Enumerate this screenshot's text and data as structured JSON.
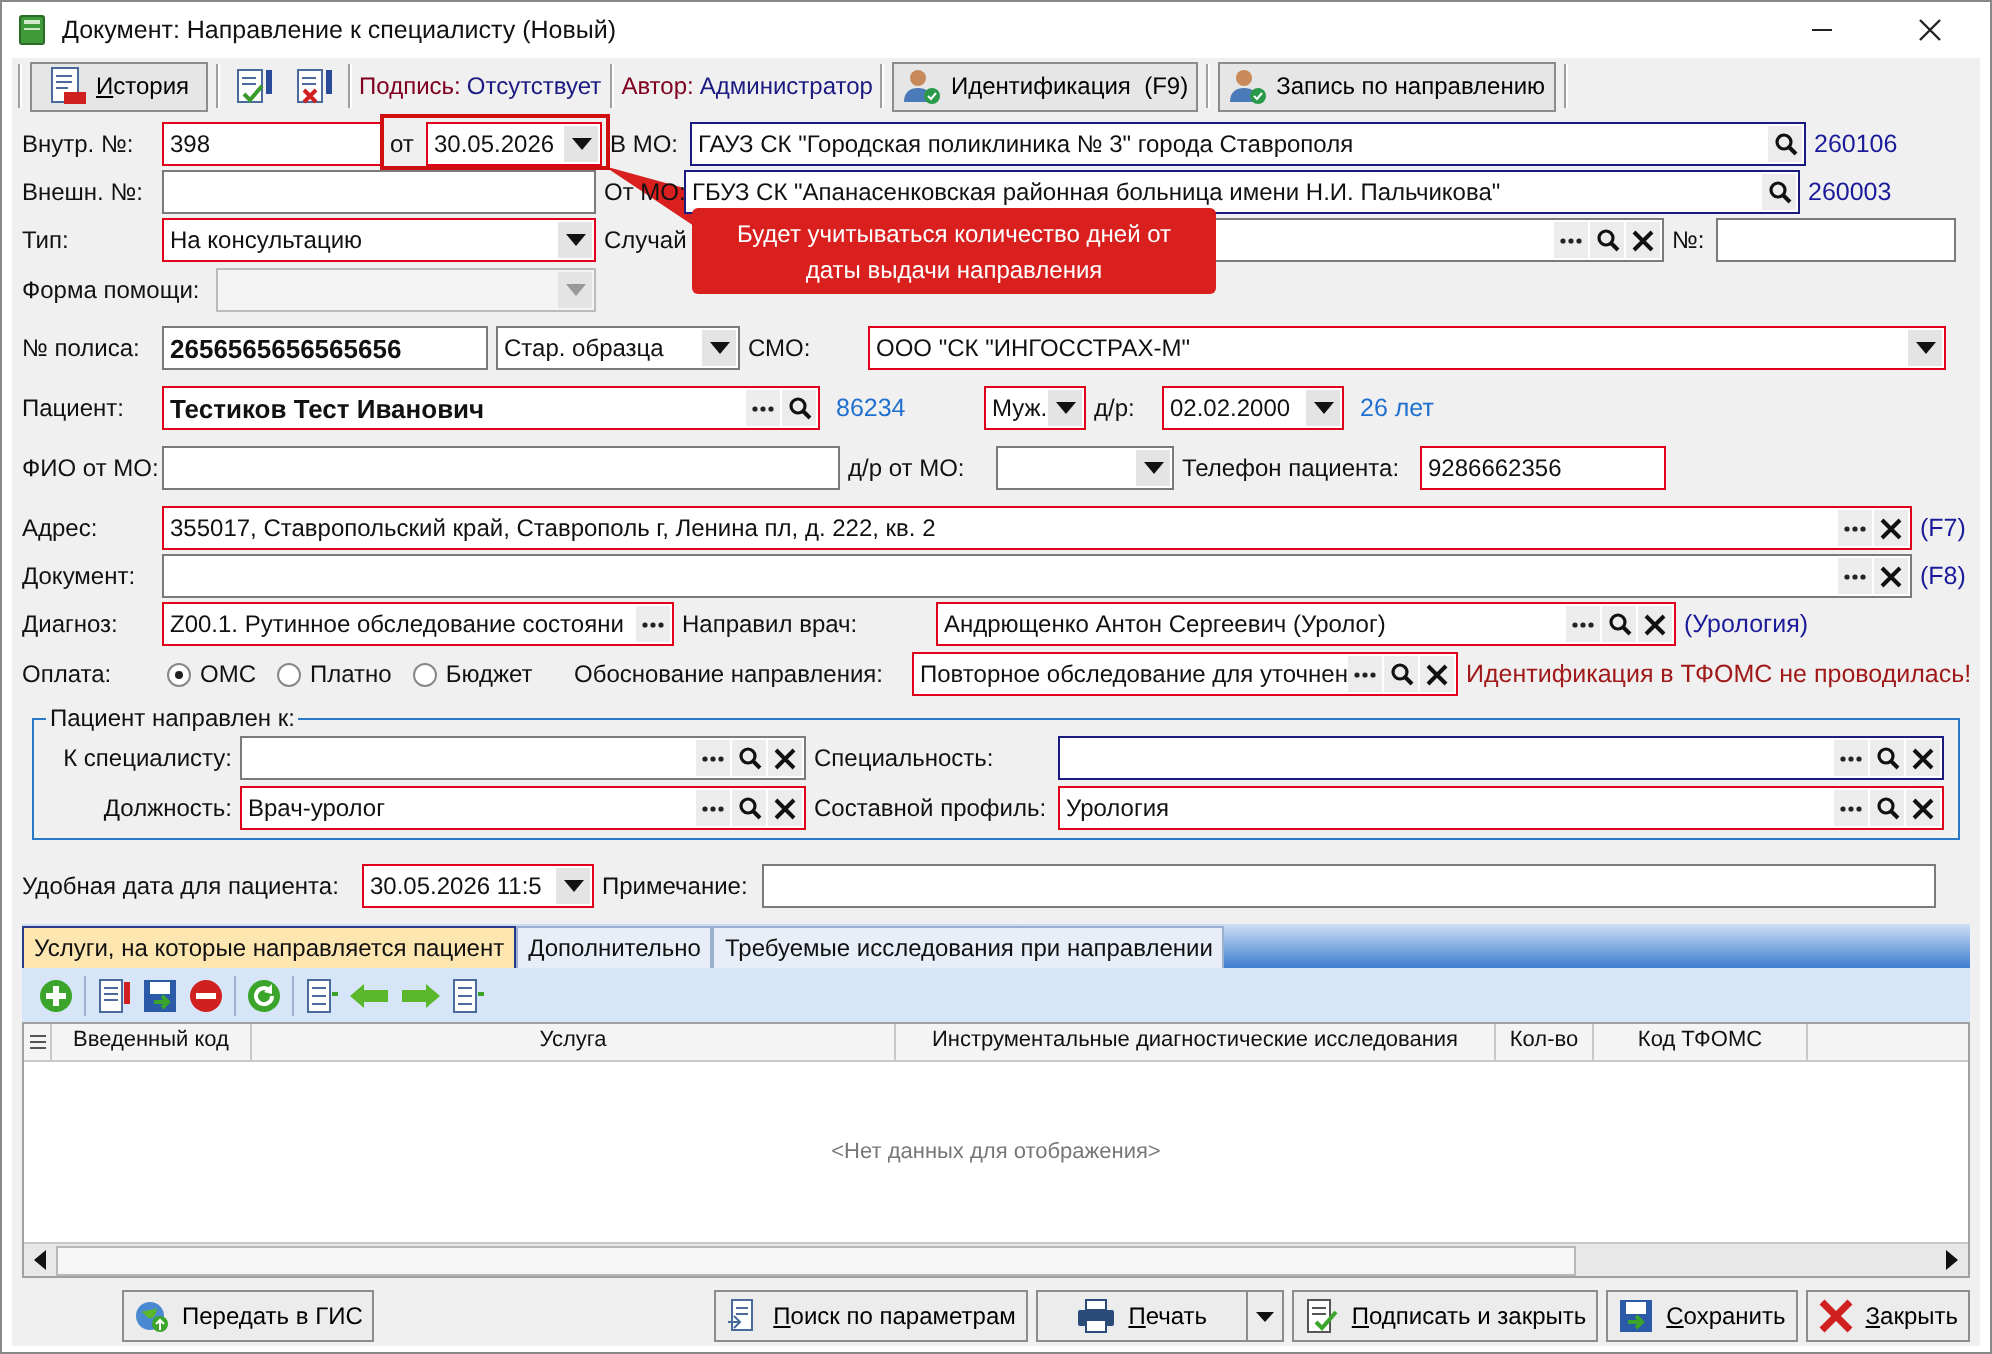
{
  "window": {
    "title": "Документ: Направление к специалисту (Новый)"
  },
  "toolbar": {
    "history_button": "История",
    "signature_label": "Подпись:",
    "signature_value": "Отсутствует",
    "author_label": "Автор:",
    "author_value": "Администратор",
    "identify_button": "Идентификация  (F9)",
    "booking_button": "Запись по направлению"
  },
  "tooltip": {
    "text": "Будет учитываться количество дней от даты выдачи направления"
  },
  "form": {
    "rows": [
      {
        "items": [
          {
            "kind": "label",
            "text": "Внутр. №:"
          },
          {
            "kind": "field",
            "value": "398",
            "required": true,
            "linked": false
          },
          {
            "kind": "label",
            "text": "от"
          },
          {
            "kind": "select",
            "value": "30.05.2026",
            "required": true,
            "linked": false,
            "disabled": false
          },
          {
            "kind": "label",
            "text": "В МО:"
          },
          {
            "kind": "field",
            "value": "ГАУЗ СК \"Городская поликлиника № 3\" города Ставрополя",
            "required": false,
            "linked": true
          },
          {
            "kind": "label",
            "text": "260106"
          }
        ]
      },
      {
        "items": [
          {
            "kind": "label",
            "text": "Внешн. №:"
          },
          {
            "kind": "field",
            "required": false,
            "linked": false
          },
          {
            "kind": "label",
            "text": "От МО:"
          },
          {
            "kind": "field",
            "value": "ГБУЗ СК \"Апанасенковская районная больница имени Н.И. Пальчикова\"",
            "required": false,
            "linked": true
          },
          {
            "kind": "label",
            "text": "260003"
          }
        ]
      },
      {
        "items": [
          {
            "kind": "label",
            "text": "Тип:"
          },
          {
            "kind": "select",
            "value": "На консультацию",
            "required": true,
            "linked": false,
            "disabled": false
          },
          {
            "kind": "label",
            "text": "Случай"
          },
          {
            "kind": "field",
            "required": false,
            "linked": false
          },
          {
            "kind": "label",
            "text": "№:"
          },
          {
            "kind": "field",
            "required": false,
            "linked": false
          }
        ]
      },
      {
        "items": [
          {
            "kind": "label",
            "text": "Форма помощи:"
          },
          {
            "kind": "select",
            "required": false,
            "linked": false,
            "disabled": true
          }
        ]
      },
      {
        "items": [
          {
            "kind": "label",
            "text": "№ полиса:"
          },
          {
            "kind": "field",
            "value": "2656565656565656",
            "required": false,
            "linked": false,
            "bold": true
          },
          {
            "kind": "select",
            "value": "Стар. образца",
            "required": false,
            "linked": false,
            "disabled": false
          },
          {
            "kind": "label",
            "text": "СМО:"
          },
          {
            "kind": "select",
            "value": "ООО \"СК \"ИНГОССТРАХ-М\"",
            "required": true,
            "linked": false,
            "disabled": false
          }
        ]
      },
      {
        "items": [
          {
            "kind": "label",
            "text": "Пациент:"
          },
          {
            "kind": "field",
            "value": "Тестиков Тест Иванович",
            "required": true,
            "linked": false,
            "bold": true
          },
          {
            "kind": "label",
            "text": "86234"
          },
          {
            "kind": "select",
            "value": "Муж.",
            "required": true,
            "linked": false,
            "disabled": false
          },
          {
            "kind": "label",
            "text": "д/р:"
          },
          {
            "kind": "select",
            "value": "02.02.2000",
            "required": true,
            "linked": false,
            "disabled": false
          },
          {
            "kind": "label",
            "text": "26 лет"
          }
        ]
      },
      {
        "items": [
          {
            "kind": "label",
            "text": "ФИО от МО:"
          },
          {
            "kind": "field",
            "required": false,
            "linked": false
          },
          {
            "kind": "label",
            "text": "д/р от МО:"
          },
          {
            "kind": "select",
            "required": false,
            "linked": false,
            "disabled": false
          },
          {
            "kind": "label",
            "text": "Телефон пациента:"
          },
          {
            "kind": "field",
            "value": "9286662356",
            "required": true,
            "linked": false
          }
        ]
      },
      {
        "items": [
          {
            "kind": "label",
            "text": "Адрес:"
          },
          {
            "kind": "field",
            "value": "355017, Ставропольский край, Ставрополь г, Ленина пл, д. 222, кв. 2",
            "required": true,
            "linked": false
          },
          {
            "kind": "label",
            "text": "(F7)"
          }
        ]
      },
      {
        "items": [
          {
            "kind": "label",
            "text": "Документ:"
          },
          {
            "kind": "field",
            "required": false,
            "linked": false
          },
          {
            "kind": "label",
            "text": "(F8)"
          }
        ]
      },
      {
        "items": [
          {
            "kind": "label",
            "text": "Диагноз:"
          },
          {
            "kind": "field",
            "value": "Z00.1. Рутинное обследование состояни",
            "required": true,
            "linked": false
          },
          {
            "kind": "label",
            "text": "Направил врач:"
          },
          {
            "kind": "field",
            "value": "Андрющенко Антон Сергеевич (Уролог)",
            "required": true,
            "linked": false
          },
          {
            "kind": "label",
            "text": "(Урология)"
          }
        ]
      },
      {
        "items": [
          {
            "kind": "label",
            "text": "Оплата:"
          },
          {
            "kind": "radios",
            "options": [
              {
                "label": "ОМС",
                "selected": true
              },
              {
                "label": "Платно",
                "selected": false
              },
              {
                "label": "Бюджет",
                "selected": false
              }
            ]
          },
          {
            "kind": "label",
            "text": "Обоснование направления:"
          },
          {
            "kind": "field",
            "value": "Повторное обследование для уточнен",
            "required": true,
            "linked": false
          },
          {
            "kind": "label",
            "text": "Идентификация в ТФОМС не проводилась!"
          }
        ]
      }
    ]
  },
  "group": {
    "title": "Пациент направлен к:",
    "rows": [
      {
        "items": [
          {
            "kind": "label",
            "text": "К специалисту:"
          },
          {
            "kind": "field",
            "required": false,
            "linked": false
          },
          {
            "kind": "label",
            "text": "Специальность:"
          },
          {
            "kind": "field",
            "required": false,
            "linked": true
          }
        ]
      },
      {
        "items": [
          {
            "kind": "label",
            "text": "Должность:"
          },
          {
            "kind": "field",
            "value": "Врач-уролог",
            "required": true,
            "linked": false
          },
          {
            "kind": "label",
            "text": "Составной профиль:"
          },
          {
            "kind": "field",
            "value": "Урология",
            "required": true,
            "linked": false
          }
        ]
      }
    ]
  },
  "date_row": {
    "items": [
      {
        "kind": "label",
        "text": "Удобная дата для пациента:"
      },
      {
        "kind": "select",
        "value": "30.05.2026 11:5",
        "required": true,
        "disabled": false
      },
      {
        "kind": "label",
        "text": "Примечание:"
      },
      {
        "kind": "field",
        "required": false
      }
    ]
  },
  "tabs": [
    {
      "label": "Услуги, на которые направляется пациент",
      "selected": true
    },
    {
      "label": "Дополнительно",
      "selected": false
    },
    {
      "label": "Требуемые исследования при направлении",
      "selected": false
    }
  ],
  "grid": {
    "columns": [
      "Введенный код",
      "Услуга",
      "Инструментальные диагностические исследования",
      "Кол-во",
      "Код ТФОМС"
    ],
    "empty_text": "<Нет данных для отображения>"
  },
  "buttons": [
    {
      "label": "Передать в ГИС",
      "mnemonic": false
    },
    {
      "label": "Поиск по параметрам",
      "mnemonic": true
    },
    {
      "label": "Печать",
      "mnemonic": true
    },
    {
      "label": "Подписать и закрыть",
      "mnemonic": true
    },
    {
      "label": "Сохранить",
      "mnemonic": true
    },
    {
      "label": "Закрыть",
      "mnemonic": true
    }
  ]
}
